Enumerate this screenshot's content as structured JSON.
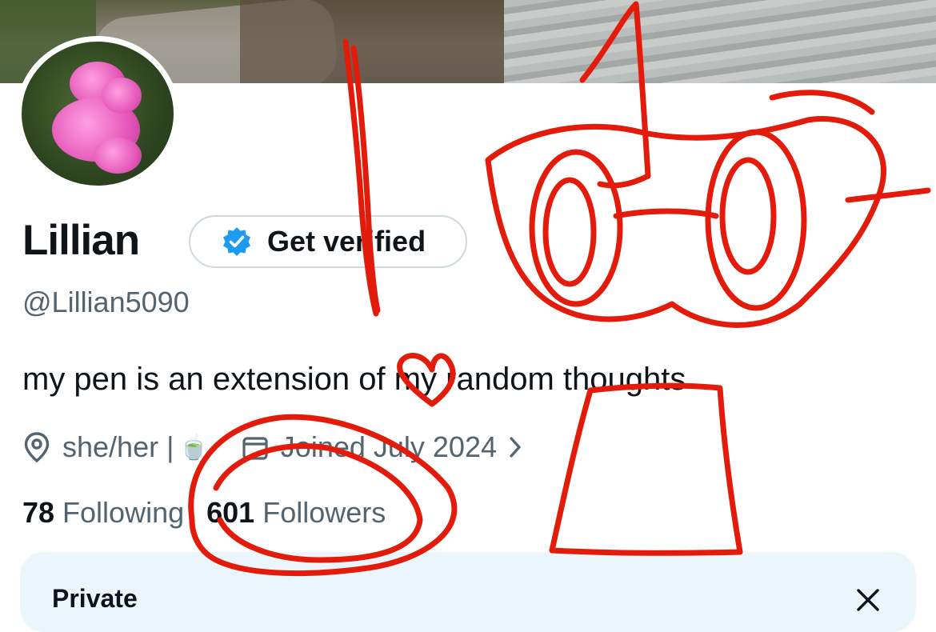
{
  "profile": {
    "name": "Lillian",
    "handle": "@Lillian5090",
    "bio": "my pen is an extension of my random thoughts",
    "pronouns": "she/her |",
    "tea_emoji": "🍵",
    "joined": "Joined July 2024",
    "following_count": "78",
    "following_label": "Following",
    "followers_count": "601",
    "followers_label": "Followers"
  },
  "verify": {
    "label": "Get verified"
  },
  "card": {
    "title": "Private"
  },
  "colors": {
    "doodle": "#e31b0b",
    "verified_badge": "#1d9bf0",
    "secondary_text": "#536471",
    "card_bg": "#eaf6fb"
  },
  "icons": [
    "location-pin-icon",
    "calendar-icon",
    "verified-badge-icon",
    "chevron-right-icon",
    "close-icon"
  ]
}
